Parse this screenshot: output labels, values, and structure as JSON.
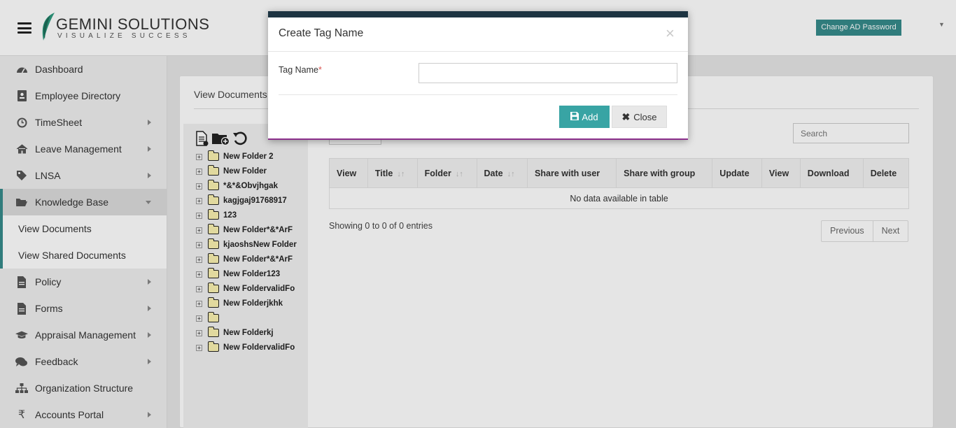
{
  "header": {
    "logo_name": "GEMINI SOLUTIONS",
    "logo_tagline": "VISUALIZE SUCCESS",
    "change_password_label": "Change AD Password"
  },
  "sidebar": {
    "items": [
      {
        "label": "Dashboard",
        "icon": "dashboard-icon"
      },
      {
        "label": "Employee Directory",
        "icon": "contact-card-icon"
      },
      {
        "label": "TimeSheet",
        "icon": "clock-icon",
        "has_submenu": true
      },
      {
        "label": "Leave Management",
        "icon": "home-icon",
        "has_submenu": true
      },
      {
        "label": "LNSA",
        "icon": "tag-icon",
        "has_submenu": true
      },
      {
        "label": "Knowledge Base",
        "icon": "folder-open-icon",
        "has_submenu": true,
        "active": true
      },
      {
        "label": "Policy",
        "icon": "file-icon",
        "has_submenu": true
      },
      {
        "label": "Forms",
        "icon": "file-text-icon",
        "has_submenu": true
      },
      {
        "label": "Appraisal Management",
        "icon": "graduation-cap-icon",
        "has_submenu": true
      },
      {
        "label": "Feedback",
        "icon": "comments-icon",
        "has_submenu": true
      },
      {
        "label": "Organization Structure",
        "icon": "sitemap-icon"
      },
      {
        "label": "Accounts Portal",
        "icon": "rupee-icon",
        "has_submenu": true
      }
    ],
    "submenu": [
      "View Documents",
      "View Shared Documents"
    ]
  },
  "main": {
    "title": "View Documents",
    "search_placeholder": "Search",
    "folders": [
      "New Folder 2",
      "New Folder",
      "*&*&Obvjhgak",
      "kagjgaj91768917",
      "123",
      "New Folder*&*ArF",
      "kjaoshsNew Folder",
      "New Folder*&*ArF",
      "New Folder123",
      "New FoldervalidFo",
      "New Folderjkhk",
      "",
      "New Folderkj",
      "New FoldervalidFo"
    ],
    "table": {
      "columns": [
        "View",
        "Title",
        "Folder",
        "Date",
        "Share with user",
        "Share with group",
        "Update",
        "View",
        "Download",
        "Delete"
      ],
      "sortable": [
        false,
        true,
        true,
        true,
        false,
        false,
        false,
        false,
        false,
        false
      ],
      "empty_message": "No data available in table"
    },
    "info": "Showing 0 to 0 of 0 entries",
    "pager": {
      "previous": "Previous",
      "next": "Next"
    }
  },
  "modal": {
    "title": "Create Tag Name",
    "close_glyph": "×",
    "field_label": "Tag Name",
    "required_mark": "*",
    "field_value": "",
    "add_label": "Add",
    "close_label": "Close"
  },
  "colors": {
    "accent": "#368b8b",
    "add_button": "#38a4a4",
    "modal_top_bar": "#1d3442"
  }
}
